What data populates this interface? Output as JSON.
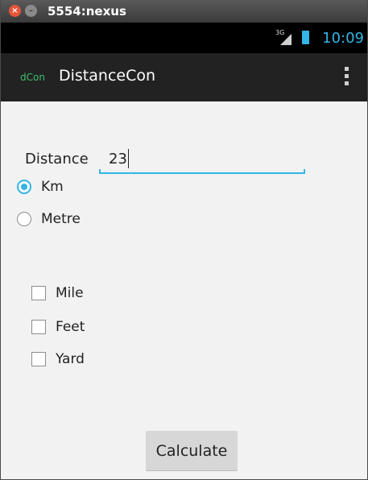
{
  "window": {
    "title": "5554:nexus"
  },
  "statusbar": {
    "network": "3G",
    "time": "10:09"
  },
  "actionbar": {
    "logo": "dCon",
    "title": "DistanceCon"
  },
  "form": {
    "distance_label": "Distance",
    "distance_value": "23",
    "radios": [
      {
        "label": "Km",
        "checked": true
      },
      {
        "label": "Metre",
        "checked": false
      }
    ],
    "checkboxes": [
      {
        "label": "Mile",
        "checked": false
      },
      {
        "label": "Feet",
        "checked": false
      },
      {
        "label": "Yard",
        "checked": false
      }
    ],
    "calculate_label": "Calculate"
  },
  "colors": {
    "accent": "#33b5e5",
    "actionbar_bg": "#222222",
    "logo": "#3fbf6f"
  },
  "icons": [
    "close-icon",
    "minimize-icon",
    "signal-icon",
    "battery-icon",
    "overflow-menu-icon"
  ]
}
